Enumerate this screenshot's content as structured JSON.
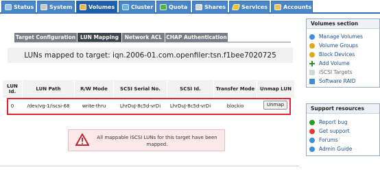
{
  "nav": {
    "tabs": [
      {
        "label": "Status",
        "icon": "status-icon"
      },
      {
        "label": "System",
        "icon": "system-icon"
      },
      {
        "label": "Volumes",
        "icon": "volumes-icon",
        "active": true
      },
      {
        "label": "Cluster",
        "icon": "cluster-icon"
      },
      {
        "label": "Quota",
        "icon": "quota-icon"
      },
      {
        "label": "Shares",
        "icon": "shares-icon"
      },
      {
        "label": "Services",
        "icon": "services-icon"
      },
      {
        "label": "Accounts",
        "icon": "accounts-icon"
      }
    ]
  },
  "subtabs": [
    "Target Configuration",
    "LUN Mapping",
    "Network ACL",
    "CHAP Authentication"
  ],
  "heading": "LUNs mapped to target: iqn.2006-01.com.openfiler:tsn.f1bee7020725",
  "table": {
    "headers": [
      "LUN Id.",
      "LUN Path",
      "R/W Mode",
      "SCSI Serial No.",
      "SCSI Id.",
      "Transfer Mode",
      "Unmap LUN"
    ],
    "row": {
      "lun_id": "0",
      "lun_path": "/dev/vg-1/iscsi-68",
      "rw_mode": "write-thru",
      "serial": "LhrDuJ-8c5d-vrDi",
      "scsi_id": "LhrDuJ-8c5d-vrDi",
      "transfer": "blockio",
      "unmap_label": "Unmap"
    }
  },
  "alert": {
    "text": "All mappable iSCSI LUNs for this target have been mapped.",
    "icon": "warning-icon"
  },
  "sidebar": {
    "volumes_title": "Volumes section",
    "volumes_items": [
      {
        "label": "Manage Volumes",
        "icon": "manage-volumes-icon"
      },
      {
        "label": "Volume Groups",
        "icon": "volume-groups-icon"
      },
      {
        "label": "Block Devices",
        "icon": "block-devices-icon"
      },
      {
        "label": "Add Volume",
        "icon": "add-icon"
      },
      {
        "label": "iSCSI Targets",
        "icon": "iscsi-targets-icon",
        "current": true
      },
      {
        "label": "Software RAID",
        "icon": "software-raid-icon"
      }
    ],
    "support_title": "Support resources",
    "support_items": [
      {
        "label": "Report bug",
        "icon": "report-bug-icon"
      },
      {
        "label": "Get support",
        "icon": "get-support-icon"
      },
      {
        "label": "Forums",
        "icon": "forums-icon"
      },
      {
        "label": "Admin Guide",
        "icon": "admin-guide-icon"
      }
    ]
  }
}
